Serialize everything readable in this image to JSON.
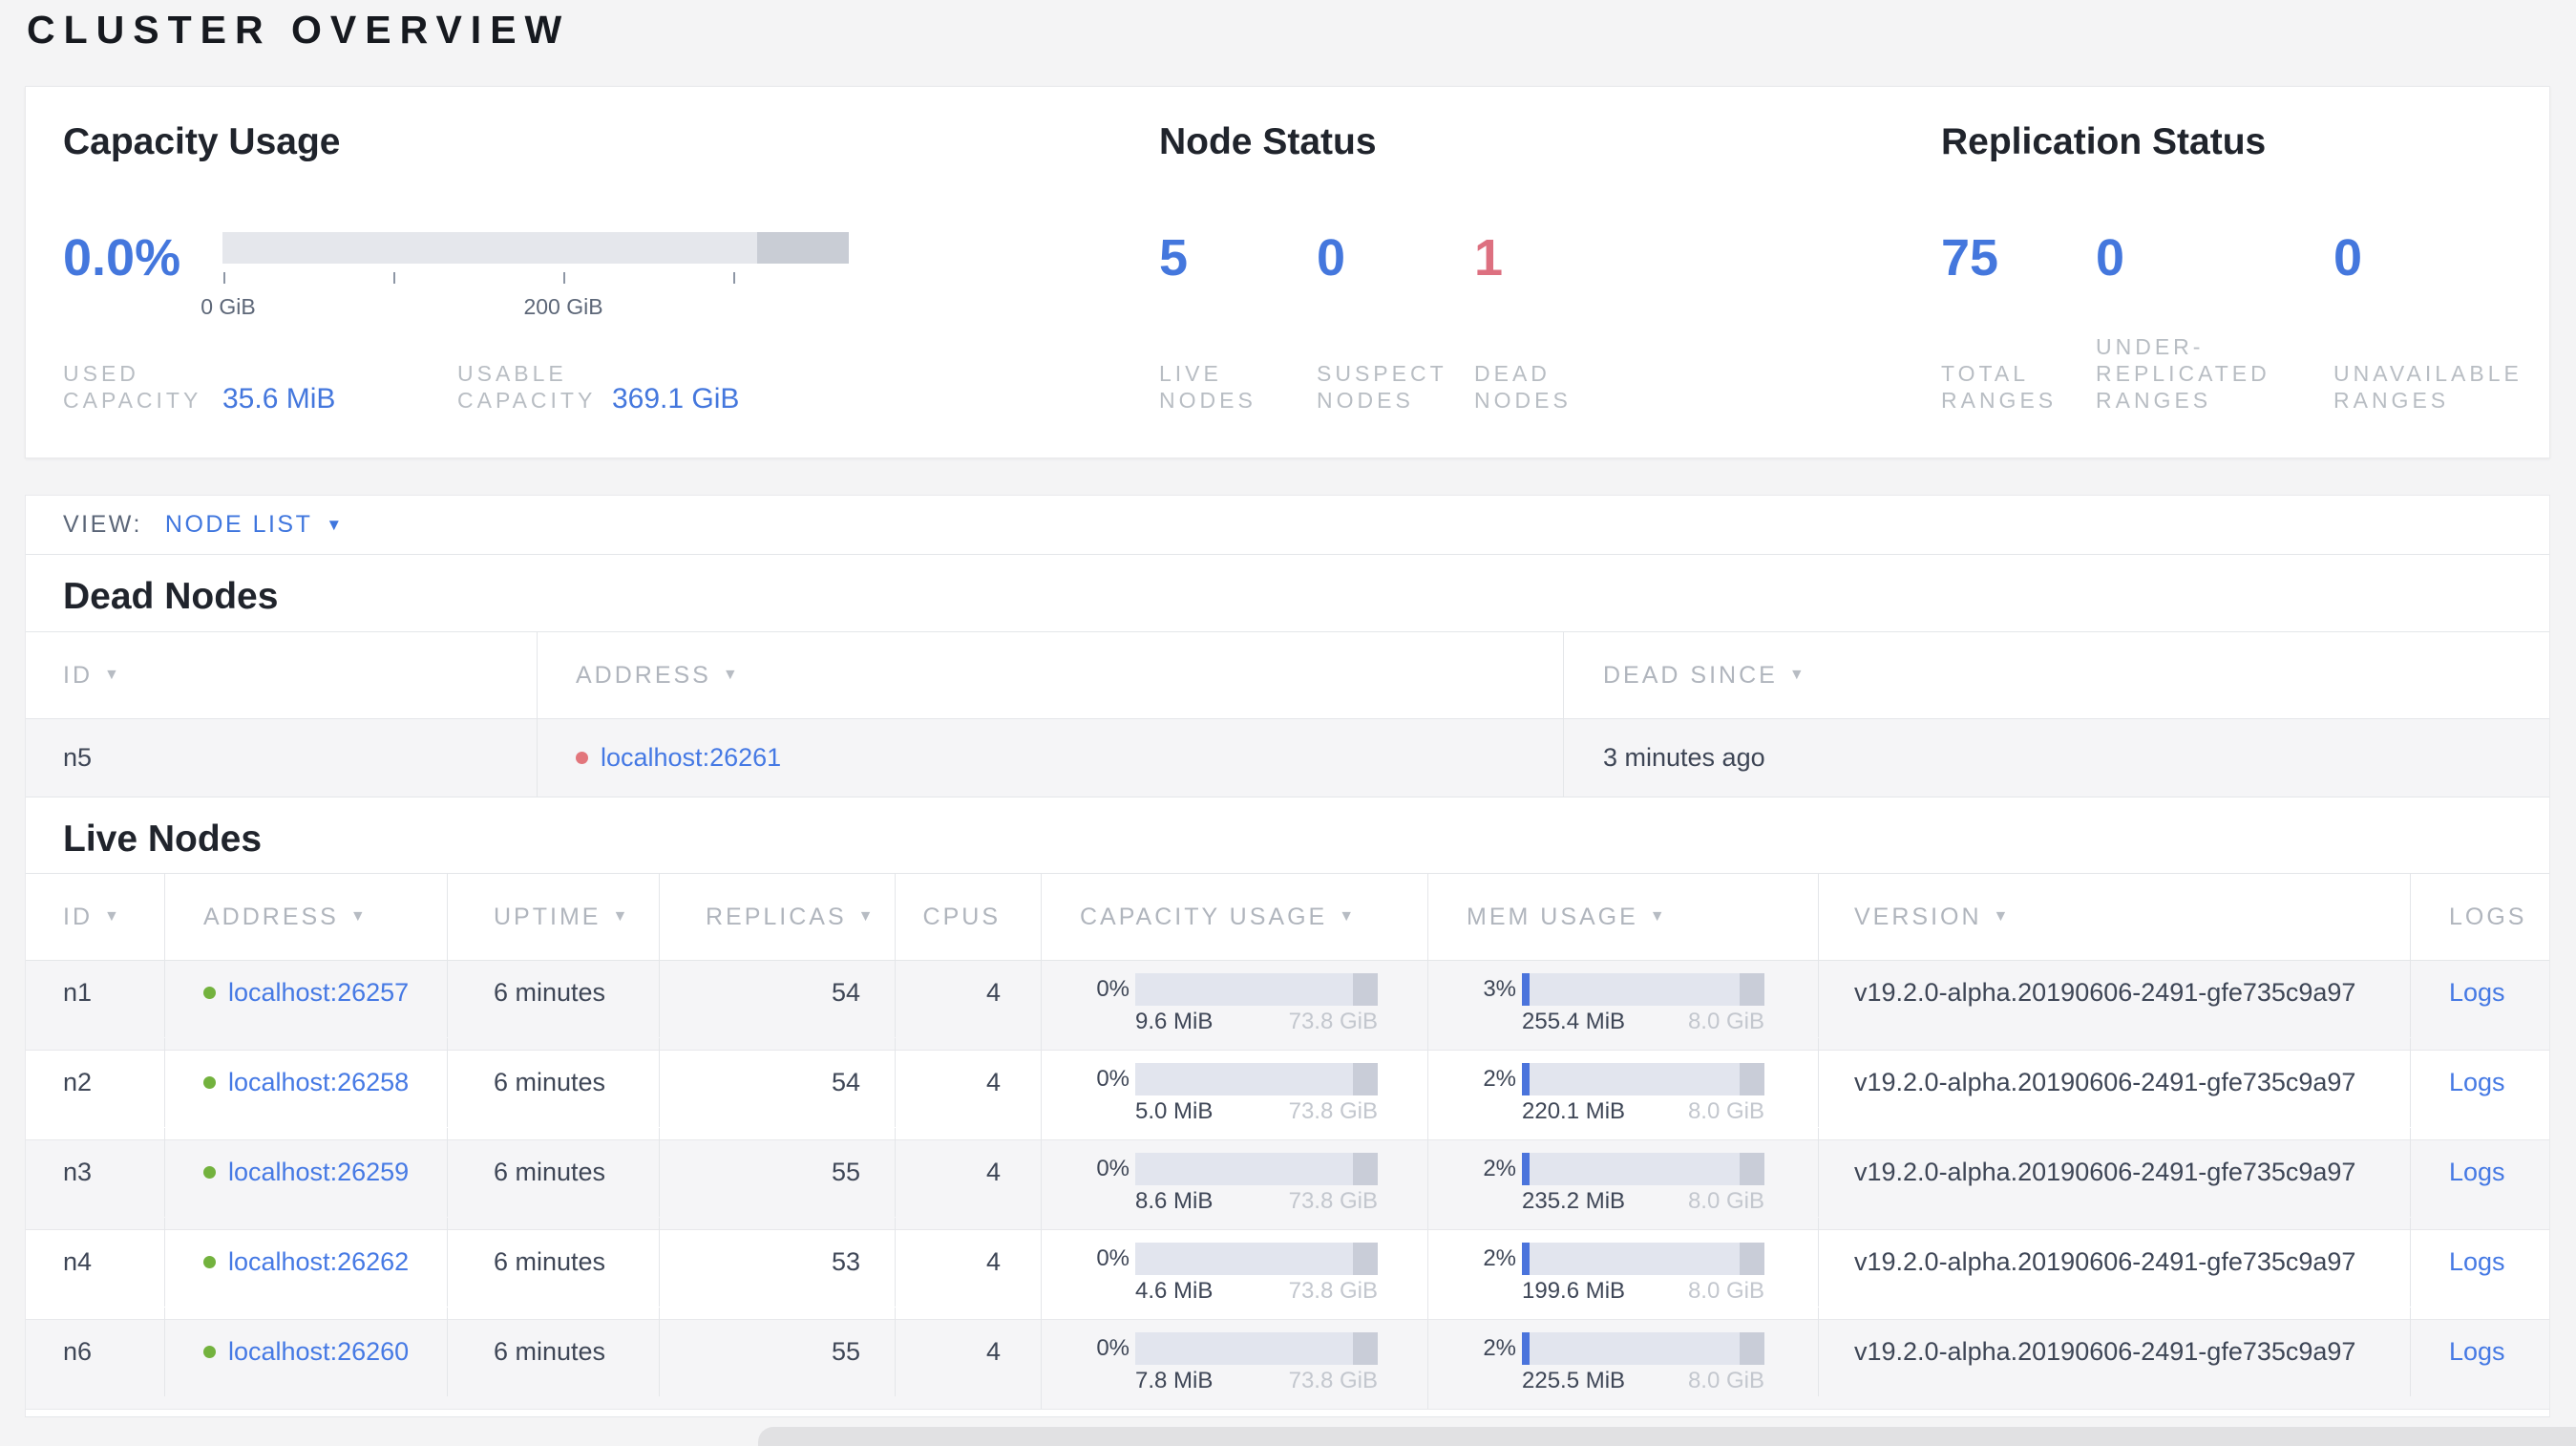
{
  "page": {
    "title": "CLUSTER OVERVIEW"
  },
  "icons": {
    "sort_arrow": "▼",
    "dropdown_caret": "▼"
  },
  "colors": {
    "accent_blue": "#4477dd",
    "link_blue": "#4579e4",
    "danger_red": "#dd7080",
    "dead_dot_red": "#e2767c",
    "live_dot_green": "#73b23e",
    "label_gray": "#b8bdc3",
    "dark_text": "#3e4656",
    "bar_track": "#e5e7ec",
    "bar_dark_segment": "#c9cdd5",
    "bar_fill_blue": "#4b74dc"
  },
  "summary": {
    "capacity": {
      "title": "Capacity Usage",
      "percent": "0.0%",
      "tick_labels": [
        "0 GiB",
        "200 GiB"
      ],
      "stats": [
        {
          "label": "USED CAPACITY",
          "value": "35.6 MiB"
        },
        {
          "label": "USABLE CAPACITY",
          "value": "369.1 GiB"
        }
      ]
    },
    "node_status": {
      "title": "Node Status",
      "stats": [
        {
          "value": "5",
          "label": "LIVE NODES",
          "tone": "blue"
        },
        {
          "value": "0",
          "label": "SUSPECT NODES",
          "tone": "blue"
        },
        {
          "value": "1",
          "label": "DEAD NODES",
          "tone": "red"
        }
      ]
    },
    "replication_status": {
      "title": "Replication Status",
      "stats": [
        {
          "value": "75",
          "label": "TOTAL RANGES",
          "tone": "blue"
        },
        {
          "value": "0",
          "label": "UNDER-REPLICATED RANGES",
          "tone": "blue"
        },
        {
          "value": "0",
          "label": "UNAVAILABLE RANGES",
          "tone": "blue"
        }
      ]
    }
  },
  "view_bar": {
    "label": "VIEW:",
    "selected": "NODE LIST"
  },
  "dead_nodes": {
    "title": "Dead Nodes",
    "columns": [
      {
        "label": "ID",
        "sortable": true
      },
      {
        "label": "ADDRESS",
        "sortable": true
      },
      {
        "label": "DEAD SINCE",
        "sortable": true
      }
    ],
    "rows": [
      {
        "id": "n5",
        "address": "localhost:26261",
        "dead_since": "3 minutes ago"
      }
    ]
  },
  "live_nodes": {
    "title": "Live Nodes",
    "columns": [
      {
        "label": "ID",
        "sortable": true
      },
      {
        "label": "ADDRESS",
        "sortable": true
      },
      {
        "label": "UPTIME",
        "sortable": true
      },
      {
        "label": "REPLICAS",
        "sortable": true
      },
      {
        "label": "CPUS",
        "sortable": false
      },
      {
        "label": "CAPACITY USAGE",
        "sortable": true
      },
      {
        "label": "MEM USAGE",
        "sortable": true
      },
      {
        "label": "VERSION",
        "sortable": true
      },
      {
        "label": "LOGS",
        "sortable": false
      }
    ],
    "rows": [
      {
        "id": "n1",
        "address": "localhost:26257",
        "uptime": "6 minutes",
        "replicas": "54",
        "cpus": "4",
        "capacity": {
          "percent": "0%",
          "percent_value": 0,
          "used": "9.6 MiB",
          "total": "73.8 GiB"
        },
        "memory": {
          "percent": "3%",
          "percent_value": 3,
          "used": "255.4 MiB",
          "total": "8.0 GiB"
        },
        "version": "v19.2.0-alpha.20190606-2491-gfe735c9a97",
        "logs": "Logs"
      },
      {
        "id": "n2",
        "address": "localhost:26258",
        "uptime": "6 minutes",
        "replicas": "54",
        "cpus": "4",
        "capacity": {
          "percent": "0%",
          "percent_value": 0,
          "used": "5.0 MiB",
          "total": "73.8 GiB"
        },
        "memory": {
          "percent": "2%",
          "percent_value": 2,
          "used": "220.1 MiB",
          "total": "8.0 GiB"
        },
        "version": "v19.2.0-alpha.20190606-2491-gfe735c9a97",
        "logs": "Logs"
      },
      {
        "id": "n3",
        "address": "localhost:26259",
        "uptime": "6 minutes",
        "replicas": "55",
        "cpus": "4",
        "capacity": {
          "percent": "0%",
          "percent_value": 0,
          "used": "8.6 MiB",
          "total": "73.8 GiB"
        },
        "memory": {
          "percent": "2%",
          "percent_value": 2,
          "used": "235.2 MiB",
          "total": "8.0 GiB"
        },
        "version": "v19.2.0-alpha.20190606-2491-gfe735c9a97",
        "logs": "Logs"
      },
      {
        "id": "n4",
        "address": "localhost:26262",
        "uptime": "6 minutes",
        "replicas": "53",
        "cpus": "4",
        "capacity": {
          "percent": "0%",
          "percent_value": 0,
          "used": "4.6 MiB",
          "total": "73.8 GiB"
        },
        "memory": {
          "percent": "2%",
          "percent_value": 2,
          "used": "199.6 MiB",
          "total": "8.0 GiB"
        },
        "version": "v19.2.0-alpha.20190606-2491-gfe735c9a97",
        "logs": "Logs"
      },
      {
        "id": "n6",
        "address": "localhost:26260",
        "uptime": "6 minutes",
        "replicas": "55",
        "cpus": "4",
        "capacity": {
          "percent": "0%",
          "percent_value": 0,
          "used": "7.8 MiB",
          "total": "73.8 GiB"
        },
        "memory": {
          "percent": "2%",
          "percent_value": 2,
          "used": "225.5 MiB",
          "total": "8.0 GiB"
        },
        "version": "v19.2.0-alpha.20190606-2491-gfe735c9a97",
        "logs": "Logs"
      }
    ]
  }
}
